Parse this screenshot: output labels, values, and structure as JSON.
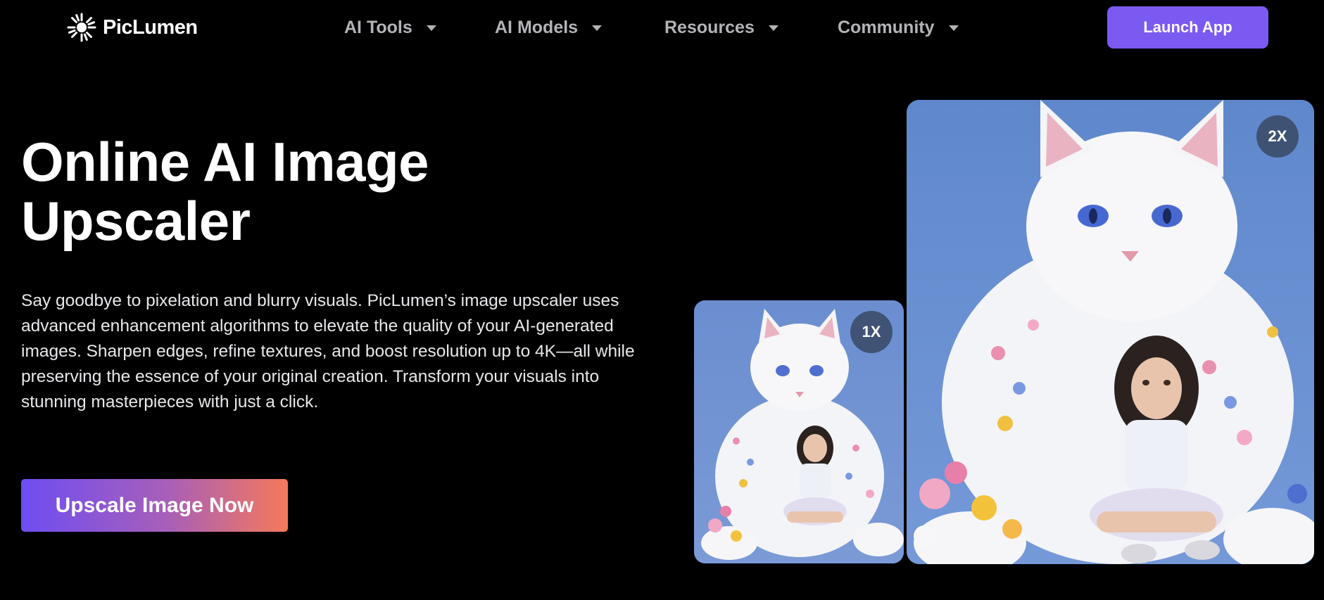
{
  "brand": {
    "name": "PicLumen",
    "logo_icon": "sunburst-icon"
  },
  "nav": {
    "items": [
      {
        "label": "AI Tools"
      },
      {
        "label": "AI Models"
      },
      {
        "label": "Resources"
      },
      {
        "label": "Community"
      }
    ],
    "launch_label": "Launch App"
  },
  "hero": {
    "title_line1": "Online AI Image",
    "title_line2": "Upscaler",
    "description": "Say goodbye to pixelation and blurry visuals. PicLumen’s image upscaler uses advanced enhancement algorithms to elevate the quality of your AI-generated images. Sharpen edges, refine textures, and boost resolution up to 4K—all while preserving the essence of your original creation. Transform your visuals into stunning masterpieces with just a click.",
    "cta_label": "Upscale Image Now"
  },
  "images": {
    "small_badge": "1X",
    "large_badge": "2X"
  },
  "colors": {
    "accent": "#7a5af0",
    "cta_gradient_start": "#6e4df2",
    "cta_gradient_end": "#f5795a",
    "background": "#000000"
  }
}
